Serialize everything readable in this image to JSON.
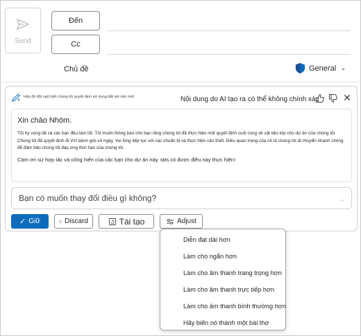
{
  "header": {
    "send_label": "Send",
    "to_label": "Đến",
    "cc_label": "Cc",
    "subject_label": "Chủ đề",
    "sensitivity_label": "General"
  },
  "copilot": {
    "tiny_hint": "Hãy để đội ngũ biết chúng tôi quyết định sử dụng đất sét mịn mới",
    "disclaimer": "Nội dung do AI tạo ra có thể không chính xác",
    "draft": {
      "greeting": "Xin chào Nhóm.",
      "paragraph1": "Tôi hy vọng tất cả các bạn đều làm tốt. Tôi muốn thông báo cho bạn rằng chúng tôi đã thực hiện một quyết định cuối cùng về vật liệu lớp cho dự án của chúng tôi. Chúng tôi đã quyết định đi Với bệnh giỏi vũ ngày. Vui lòng tiếp tục với các chuẩn bị và thực hiện cần thiết. Điều quan trọng của nó là chúng tôi di chuyển nhanh chóng để đảm bảo chúng tôi đáp ứng thời hạn của chúng tôi.",
      "thanks": "Cảm ơn sự hợp tác và cống hiến của các bạn cho dự án này. tats có được điều này thực hiện!"
    },
    "prompt_placeholder": "Bạn có muốn thay đổi điều gì không?",
    "actions": {
      "keep": "Giữ",
      "discard": "Discard",
      "regenerate": "Tái tạo",
      "adjust": "Adjust"
    }
  },
  "adjust_menu": {
    "items": [
      "Diễn đạt dài hơn",
      "Làm cho ngắn hơn",
      "Làm cho âm thanh trang trọng hơn",
      "Làm cho âm thanh trực tiếp hơn",
      "Làm cho âm thanh bình thường hơn",
      "Hãy biến nó thành một bài thơ"
    ]
  },
  "colors": {
    "accent": "#0f6cbd",
    "shield": "#0f6cbd"
  }
}
